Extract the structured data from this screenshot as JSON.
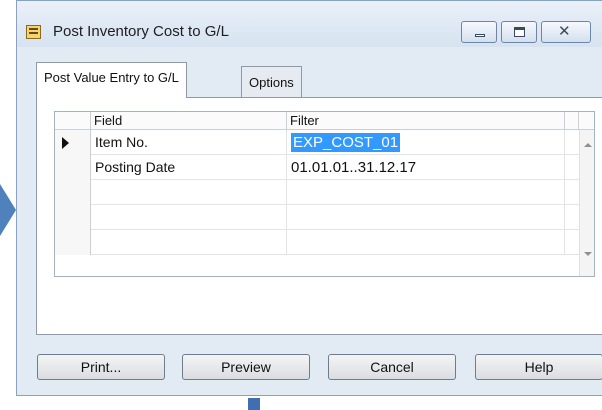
{
  "window": {
    "title": "Post Inventory Cost to G/L",
    "controls": [
      "minimize",
      "maximize",
      "close"
    ],
    "close_glyph": "✕"
  },
  "tabs": [
    {
      "label": "Post Value Entry to G/L",
      "active": true
    },
    {
      "label": "Options",
      "active": false
    }
  ],
  "grid": {
    "headers": {
      "field": "Field",
      "filter": "Filter"
    },
    "rows": [
      {
        "field": "Item No.",
        "filter": "EXP_COST_01",
        "current": true,
        "selected": true
      },
      {
        "field": "Posting Date",
        "filter": "01.01.01..31.12.17"
      },
      {
        "field": "",
        "filter": ""
      },
      {
        "field": "",
        "filter": ""
      },
      {
        "field": "",
        "filter": ""
      }
    ]
  },
  "buttons": {
    "print": "Print...",
    "preview": "Preview",
    "cancel": "Cancel",
    "help": "Help"
  },
  "colors": {
    "selection_highlight": "#3399ff",
    "window_background": "#e2eaf4",
    "backdrop_accent": "#4f81bd"
  },
  "icons": {
    "app": "report-icon",
    "row_pointer": "row-pointer-icon"
  }
}
